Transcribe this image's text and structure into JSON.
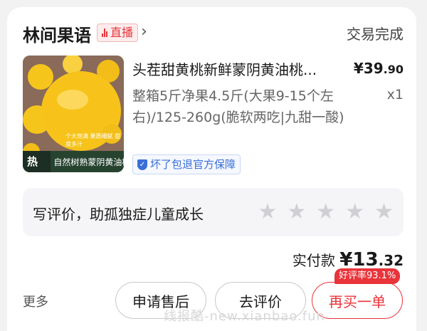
{
  "shop": {
    "name": "林间果语",
    "live_label": "直播",
    "chevron": "›"
  },
  "order": {
    "status": "交易完成"
  },
  "product": {
    "title": "头茬甜黄桃新鲜蒙阴黄油桃...",
    "price_int": "¥39",
    "price_dec": ".90",
    "spec": "整箱5斤净果4.5斤(大果9-15个左右)/125-260g(脆软两吃|九甜一酸)",
    "qty": "x1",
    "guarantee": "坏了包退官方保障",
    "image_hot_label": "热卖",
    "image_caption": "自然树熟蒙阴黄油桃",
    "image_subtext": "个大饱满 果质细腻 甜度多汁"
  },
  "review": {
    "prompt": "写评价，助孤独症儿童成长",
    "stars": [
      "★",
      "★",
      "★",
      "★",
      "★"
    ]
  },
  "payment": {
    "label": "实付款",
    "amount_int": "¥13",
    "amount_dec": ".32"
  },
  "actions": {
    "more": "更多",
    "after_sale": "申请售后",
    "review": "去评价",
    "rebuy": "再买一单",
    "good_rate": "好评率93.1%"
  },
  "watermark": "线报酷-new.xianbao.fun",
  "colors": {
    "accent_red": "#e8343a",
    "guarantee_blue": "#3a6fd8",
    "star_gray": "#d0d0d4"
  }
}
